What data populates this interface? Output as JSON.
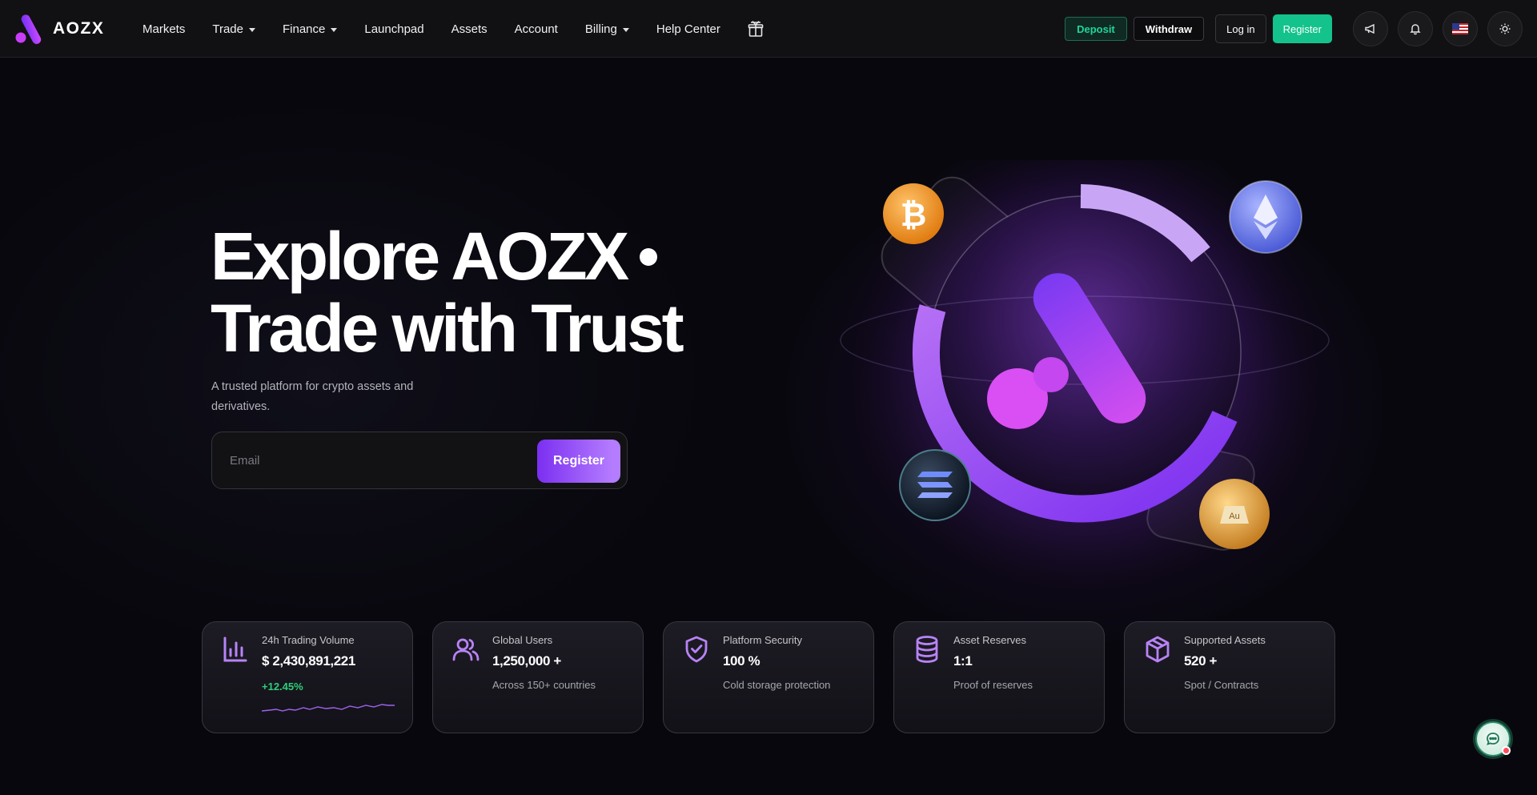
{
  "brand": {
    "name": "AOZX"
  },
  "nav": {
    "items": [
      {
        "label": "Markets",
        "has_dropdown": false
      },
      {
        "label": "Trade",
        "has_dropdown": true
      },
      {
        "label": "Finance",
        "has_dropdown": true
      },
      {
        "label": "Launchpad",
        "has_dropdown": false
      },
      {
        "label": "Assets",
        "has_dropdown": false
      },
      {
        "label": "Account",
        "has_dropdown": false
      },
      {
        "label": "Billing",
        "has_dropdown": true
      },
      {
        "label": "Help Center",
        "has_dropdown": false
      }
    ],
    "gift_icon": "gift-icon",
    "deposit_label": "Deposit",
    "withdraw_label": "Withdraw",
    "login_label": "Log in",
    "register_label": "Register",
    "announcement_icon": "megaphone-icon",
    "notification_icon": "bell-icon",
    "language_icon": "us-flag-icon",
    "theme_icon": "sun-icon"
  },
  "hero": {
    "title_line1": "Explore AOZX",
    "title_line2": "Trade with Trust",
    "subtitle": "A trusted platform for crypto assets and derivatives.",
    "email_placeholder": "Email",
    "register_label": "Register",
    "coin_icons": [
      "bitcoin-icon",
      "ethereum-icon",
      "solana-icon",
      "gold-icon"
    ]
  },
  "stats": [
    {
      "icon": "bar-chart-icon",
      "label": "24h Trading Volume",
      "value": "$ 2,430,891,221",
      "change": "+12.45%",
      "sub": ""
    },
    {
      "icon": "users-icon",
      "label": "Global Users",
      "value": "1,250,000 +",
      "change": "",
      "sub": "Across 150+ countries"
    },
    {
      "icon": "shield-check-icon",
      "label": "Platform Security",
      "value": "100 %",
      "change": "",
      "sub": "Cold storage protection"
    },
    {
      "icon": "database-icon",
      "label": "Asset Reserves",
      "value": "1:1",
      "change": "",
      "sub": "Proof of reserves"
    },
    {
      "icon": "cube-icon",
      "label": "Supported Assets",
      "value": "520 +",
      "change": "",
      "sub": "Spot / Contracts"
    }
  ],
  "chat": {
    "icon": "chat-icon"
  },
  "colors": {
    "accent_purple": "#7b2ff0",
    "accent_green": "#13c38b",
    "positive": "#2ecf7a",
    "background": "#08070d"
  }
}
